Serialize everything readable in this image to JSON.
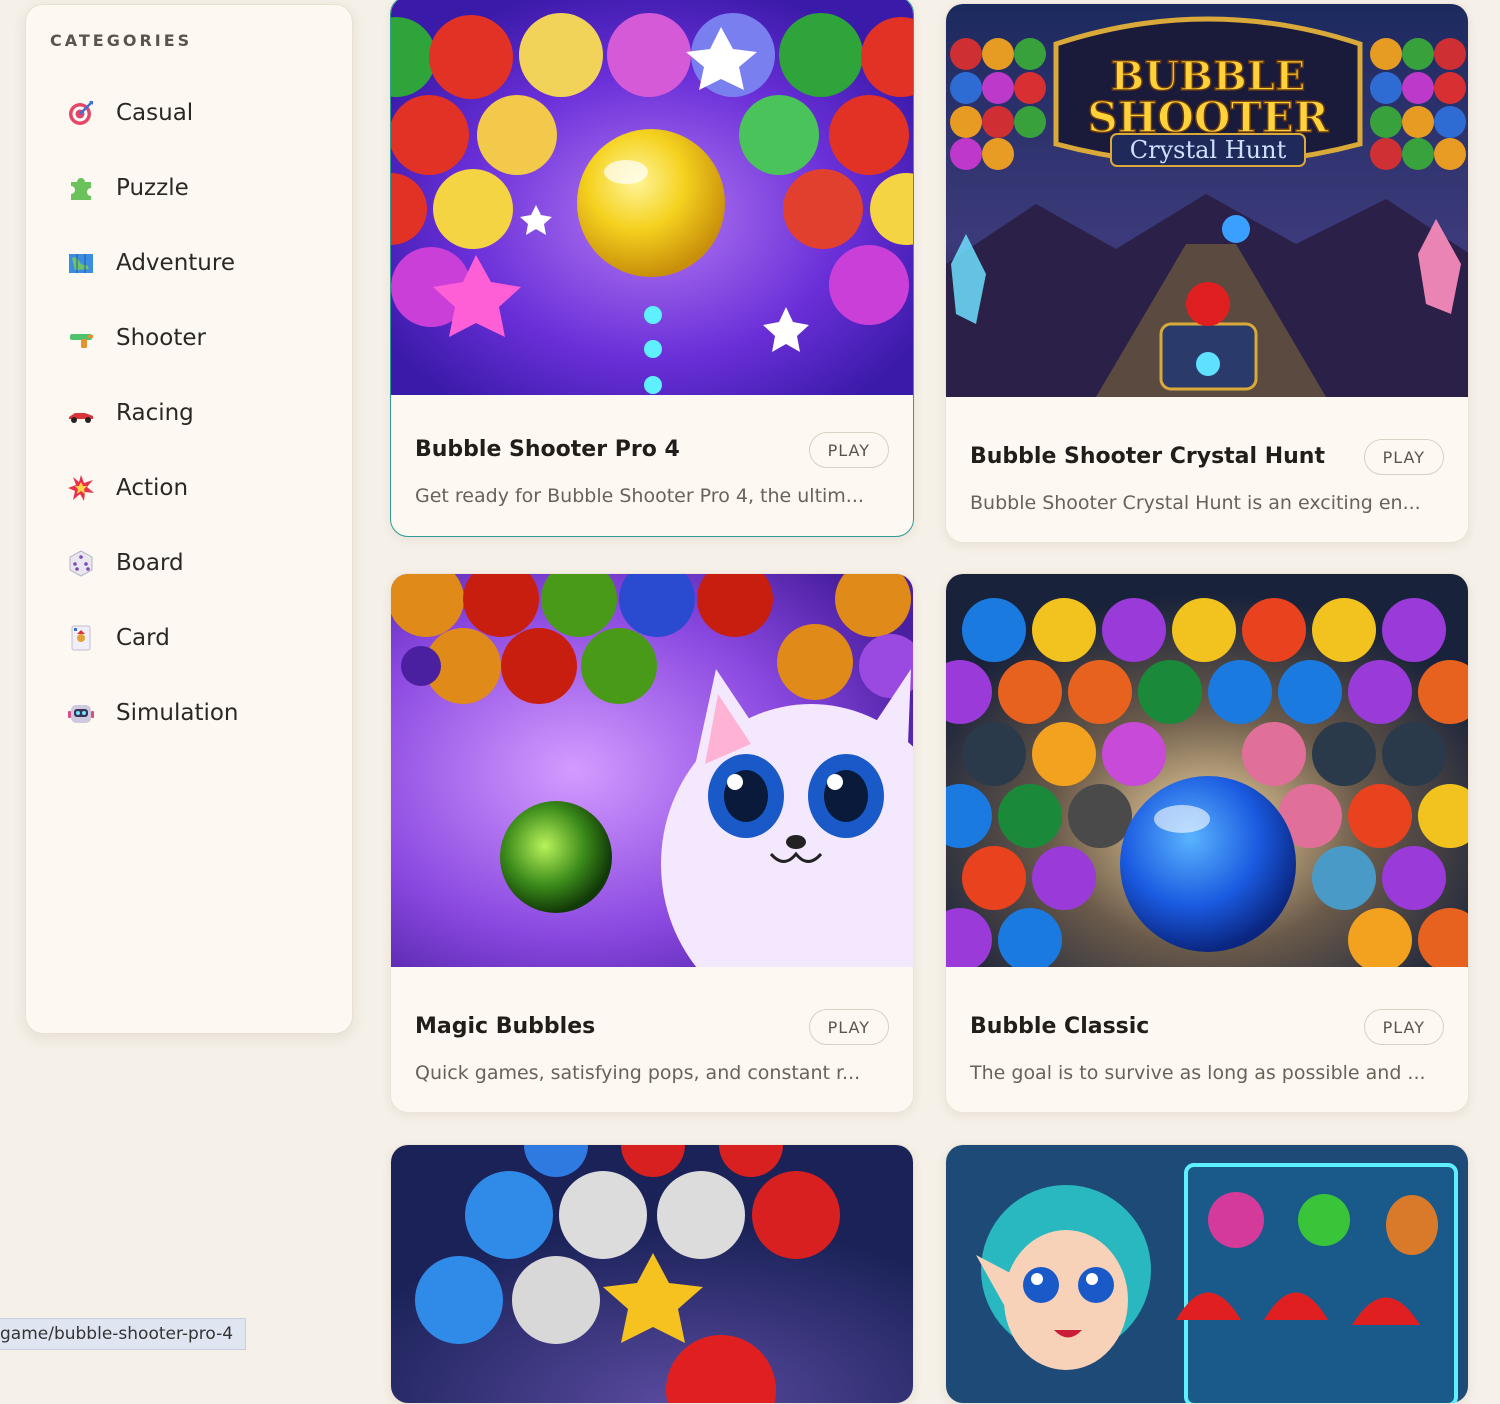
{
  "sidebar": {
    "title": "CATEGORIES",
    "items": [
      {
        "label": "Casual",
        "icon": "dart-target-icon"
      },
      {
        "label": "Puzzle",
        "icon": "puzzle-piece-icon"
      },
      {
        "label": "Adventure",
        "icon": "map-icon"
      },
      {
        "label": "Shooter",
        "icon": "water-pistol-icon"
      },
      {
        "label": "Racing",
        "icon": "race-car-icon"
      },
      {
        "label": "Action",
        "icon": "collision-icon"
      },
      {
        "label": "Board",
        "icon": "dice-icon"
      },
      {
        "label": "Card",
        "icon": "joker-card-icon"
      },
      {
        "label": "Simulation",
        "icon": "robot-icon"
      }
    ]
  },
  "games": [
    {
      "title": "Bubble Shooter Pro 4",
      "desc": "Get ready for Bubble Shooter Pro 4, the ultim...",
      "play": "PLAY"
    },
    {
      "title": "Bubble Shooter Crystal Hunt",
      "desc": "Bubble Shooter Crystal Hunt is an exciting en...",
      "play": "PLAY",
      "logo_text": [
        "BUBBLE",
        "SHOOTER",
        "Crystal Hunt"
      ]
    },
    {
      "title": "Magic Bubbles",
      "desc": "Quick games, satisfying pops, and constant r...",
      "play": "PLAY"
    },
    {
      "title": "Bubble Classic",
      "desc": "The goal is to survive as long as possible and ...",
      "play": "PLAY"
    }
  ],
  "status_bar": {
    "url": "game/bubble-shooter-pro-4"
  }
}
